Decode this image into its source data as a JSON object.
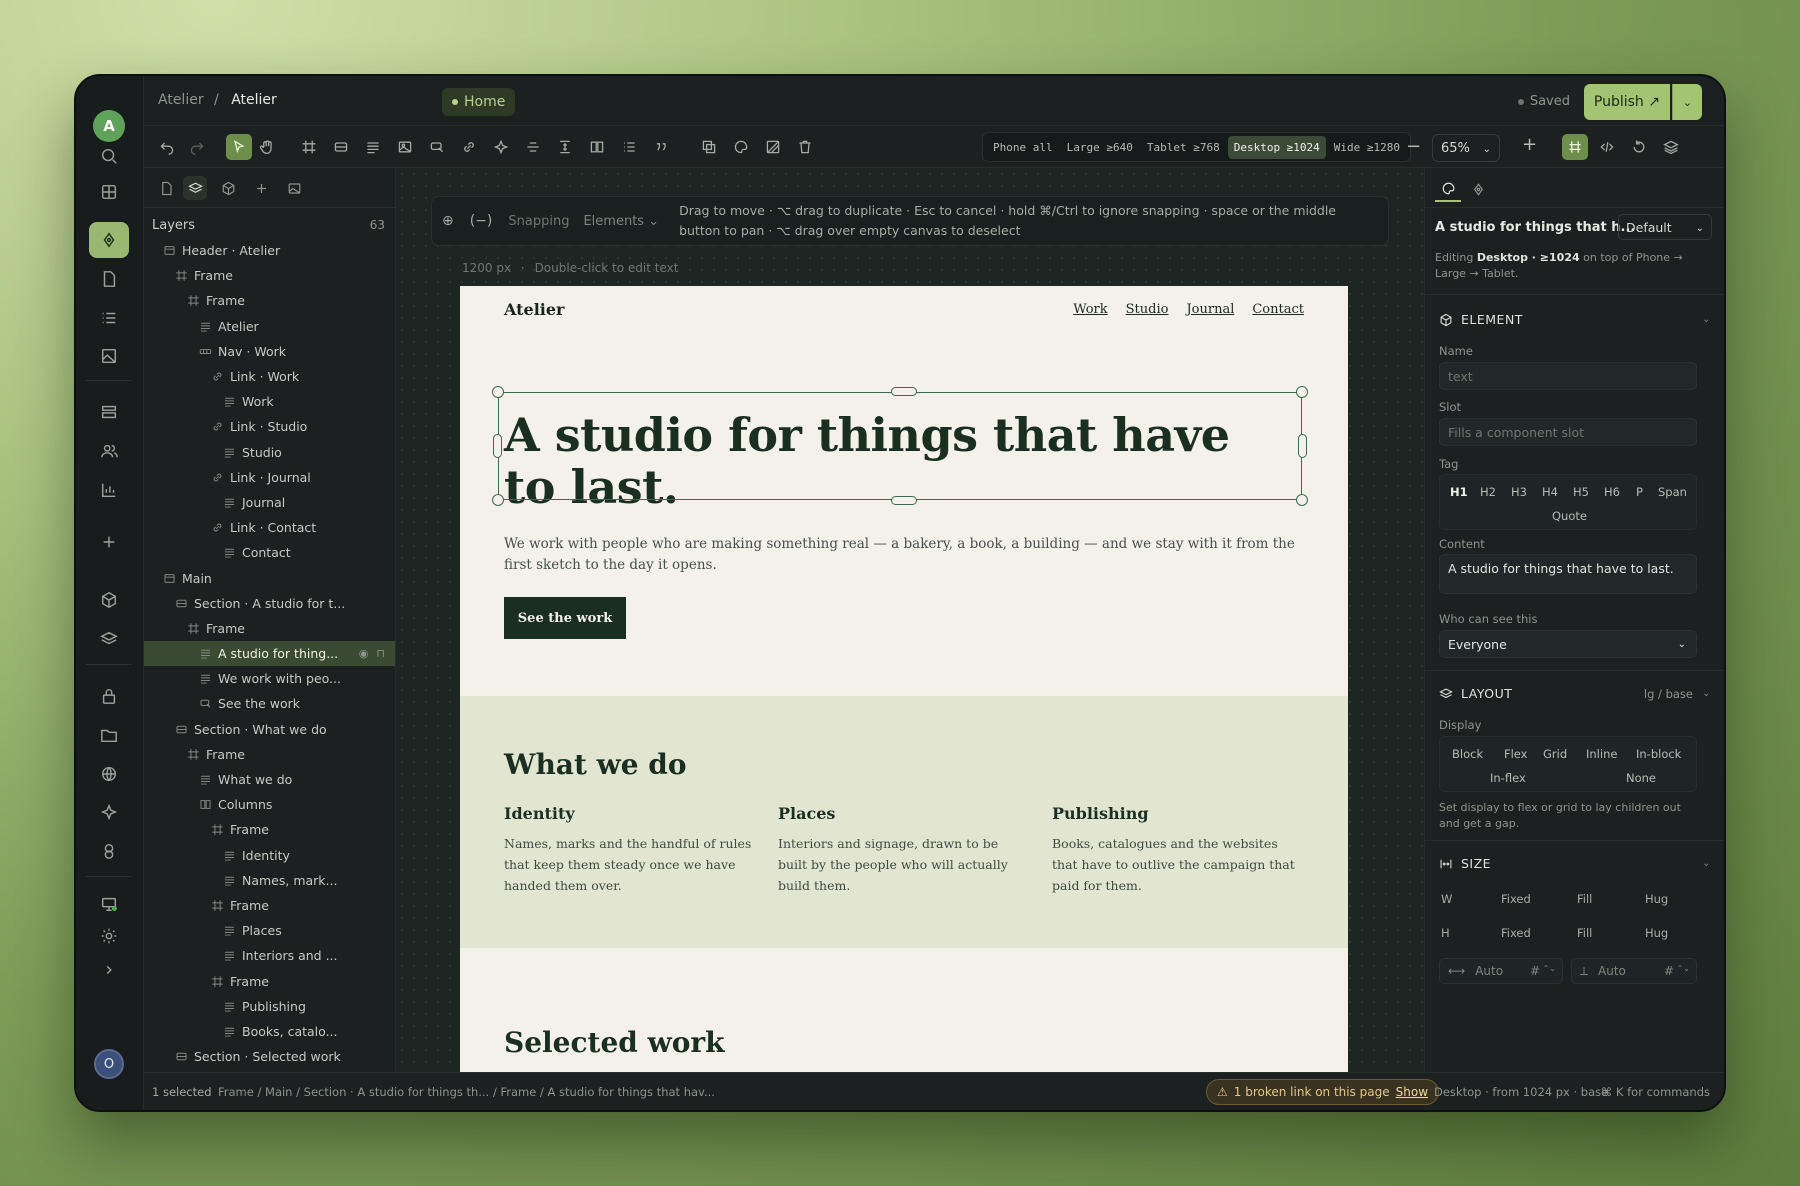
{
  "rail": {
    "avatar_top": "A",
    "avatar_bottom": "O"
  },
  "topbar": {
    "crumb_root": "Atelier",
    "crumb_sep": "/",
    "crumb_current": "Atelier",
    "page_pill": "Home",
    "saved": "Saved",
    "publish": "Publish ↗"
  },
  "breakpoints": [
    {
      "label": "Phone all"
    },
    {
      "label": "Large ≥640"
    },
    {
      "label": "Tablet ≥768"
    },
    {
      "label": "Desktop ≥1024",
      "active": true
    },
    {
      "label": "Wide ≥1280"
    }
  ],
  "zoom": {
    "value": "65%"
  },
  "layers": {
    "title": "Layers",
    "count": "63",
    "items": [
      {
        "label": "Header · Atelier",
        "depth": 0,
        "icon": "section"
      },
      {
        "label": "Frame",
        "depth": 1,
        "icon": "frame"
      },
      {
        "label": "Frame",
        "depth": 2,
        "icon": "frame"
      },
      {
        "label": "Atelier",
        "depth": 3,
        "icon": "text"
      },
      {
        "label": "Nav · Work",
        "depth": 3,
        "icon": "nav"
      },
      {
        "label": "Link · Work",
        "depth": 4,
        "icon": "link"
      },
      {
        "label": "Work",
        "depth": 5,
        "icon": "text"
      },
      {
        "label": "Link · Studio",
        "depth": 4,
        "icon": "link"
      },
      {
        "label": "Studio",
        "depth": 5,
        "icon": "text"
      },
      {
        "label": "Link · Journal",
        "depth": 4,
        "icon": "link"
      },
      {
        "label": "Journal",
        "depth": 5,
        "icon": "text"
      },
      {
        "label": "Link · Contact",
        "depth": 4,
        "icon": "link"
      },
      {
        "label": "Contact",
        "depth": 5,
        "icon": "text"
      },
      {
        "label": "Main",
        "depth": 0,
        "icon": "section"
      },
      {
        "label": "Section · A studio for t...",
        "depth": 1,
        "icon": "sectionrow"
      },
      {
        "label": "Frame",
        "depth": 2,
        "icon": "frame"
      },
      {
        "label": "A studio for thing...",
        "depth": 3,
        "icon": "text",
        "selected": true
      },
      {
        "label": "We work with peo...",
        "depth": 3,
        "icon": "text"
      },
      {
        "label": "See the work",
        "depth": 3,
        "icon": "button"
      },
      {
        "label": "Section · What we do",
        "depth": 1,
        "icon": "sectionrow"
      },
      {
        "label": "Frame",
        "depth": 2,
        "icon": "frame"
      },
      {
        "label": "What we do",
        "depth": 3,
        "icon": "text"
      },
      {
        "label": "Columns",
        "depth": 3,
        "icon": "columns"
      },
      {
        "label": "Frame",
        "depth": 4,
        "icon": "frame"
      },
      {
        "label": "Identity",
        "depth": 5,
        "icon": "text"
      },
      {
        "label": "Names, mark...",
        "depth": 5,
        "icon": "text"
      },
      {
        "label": "Frame",
        "depth": 4,
        "icon": "frame"
      },
      {
        "label": "Places",
        "depth": 5,
        "icon": "text"
      },
      {
        "label": "Interiors and ...",
        "depth": 5,
        "icon": "text"
      },
      {
        "label": "Frame",
        "depth": 4,
        "icon": "frame"
      },
      {
        "label": "Publishing",
        "depth": 5,
        "icon": "text"
      },
      {
        "label": "Books, catalo...",
        "depth": 5,
        "icon": "text"
      },
      {
        "label": "Section · Selected work",
        "depth": 1,
        "icon": "sectionrow"
      }
    ]
  },
  "canvas": {
    "hint_snapping": "Snapping",
    "hint_elements": "Elements",
    "hint_text": "Drag to move · ⌥ drag to duplicate · Esc to cancel · hold ⌘/Ctrl to ignore snapping · space or the middle button to pan · ⌥ drag over empty canvas to deselect",
    "width_label": "1200 px",
    "width_dot": "·",
    "width_hint": "Double-click to edit text"
  },
  "site": {
    "logo": "Atelier",
    "nav": [
      "Work",
      "Studio",
      "Journal",
      "Contact"
    ],
    "hero_title": "A studio for things that have to last.",
    "hero_text": "We work with people who are making something real — a bakery, a book, a building — and we stay with it from the first sketch to the day it opens.",
    "hero_button": "See the work",
    "what_title": "What we do",
    "columns": [
      {
        "title": "Identity",
        "text": "Names, marks and the handful of rules that keep them steady once we have handed them over."
      },
      {
        "title": "Places",
        "text": "Interiors and signage, drawn to be built by the people who will actually build them."
      },
      {
        "title": "Publishing",
        "text": "Books, catalogues and the websites that have to outlive the campaign that paid for them."
      }
    ],
    "selected_title": "Selected work"
  },
  "inspector": {
    "element_title": "A studio for things that h...",
    "variant": "Default",
    "editing_prefix": "Editing",
    "editing_bp": "Desktop · ≥1024",
    "editing_suffix": "on top of Phone → Large → Tablet.",
    "element_section": "ELEMENT",
    "name_label": "Name",
    "name_placeholder": "text",
    "slot_label": "Slot",
    "slot_placeholder": "Fills a component slot",
    "tag_label": "Tag",
    "tags": [
      "H1",
      "H2",
      "H3",
      "H4",
      "H5",
      "H6",
      "P",
      "Span",
      "Quote"
    ],
    "content_label": "Content",
    "content_value": "A studio for things that have to last.",
    "visibility_label": "Who can see this",
    "visibility_value": "Everyone",
    "layout_section": "LAYOUT",
    "layout_scope": "lg / base",
    "display_label": "Display",
    "display_options": [
      "Block",
      "Flex",
      "Grid",
      "Inline",
      "In-block",
      "In-flex",
      "None"
    ],
    "display_help": "Set display to flex or grid to lay children out and get a gap.",
    "size_section": "SIZE",
    "w_label": "W",
    "h_label": "H",
    "size_options": [
      "Fixed",
      "Fill",
      "Hug"
    ],
    "auto_w": "Auto",
    "auto_h": "Auto",
    "hash": "#"
  },
  "statusbar": {
    "selected": "1 selected",
    "path": "Frame / Main / Section · A studio for things th... / Frame / A studio for things that hav...",
    "warning": "1 broken link on this page",
    "warning_action": "Show",
    "bp_info": "Desktop · from 1024 px · base",
    "shortcut": "⌘ K for commands"
  },
  "colors": {
    "accent": "#a3c472",
    "canvas_bg": "#1e2624",
    "site_bg": "#f3f1e8",
    "band_bg": "#e2e6d1",
    "ink": "#1b2e22"
  }
}
